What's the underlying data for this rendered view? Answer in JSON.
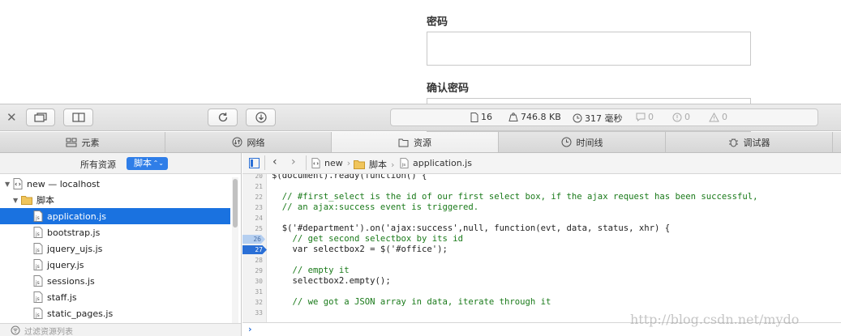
{
  "web": {
    "password_label": "密码",
    "confirm_label": "确认密码"
  },
  "toolbar": {
    "stats": {
      "requests": "16",
      "size": "746.8 KB",
      "time": "317 毫秒",
      "logs": "0",
      "errors": "0",
      "warnings": "0"
    }
  },
  "tabs": [
    {
      "label": "元素",
      "icon": "elements-icon"
    },
    {
      "label": "网络",
      "icon": "network-icon"
    },
    {
      "label": "资源",
      "icon": "resources-icon"
    },
    {
      "label": "时间线",
      "icon": "timeline-icon"
    },
    {
      "label": "调试器",
      "icon": "debugger-icon"
    }
  ],
  "sidebar": {
    "header_label": "所有资源",
    "select_value": "脚本",
    "tree": [
      {
        "label": "new — localhost",
        "level": 0,
        "type": "page",
        "selected": false
      },
      {
        "label": "脚本",
        "level": 1,
        "type": "folder",
        "selected": false
      },
      {
        "label": "application.js",
        "level": 2,
        "type": "js",
        "selected": true
      },
      {
        "label": "bootstrap.js",
        "level": 2,
        "type": "js",
        "selected": false
      },
      {
        "label": "jquery_ujs.js",
        "level": 2,
        "type": "js",
        "selected": false
      },
      {
        "label": "jquery.js",
        "level": 2,
        "type": "js",
        "selected": false
      },
      {
        "label": "sessions.js",
        "level": 2,
        "type": "js",
        "selected": false
      },
      {
        "label": "staff.js",
        "level": 2,
        "type": "js",
        "selected": false
      },
      {
        "label": "static_pages.js",
        "level": 2,
        "type": "js",
        "selected": false
      }
    ],
    "filter_placeholder": "过滤资源列表"
  },
  "breadcrumb": [
    "new",
    "脚本",
    "application.js"
  ],
  "code": {
    "lines": [
      {
        "n": "20",
        "text": "$(document).ready(function() {",
        "comment": false,
        "bp": "none"
      },
      {
        "n": "21",
        "text": "",
        "comment": false,
        "bp": "none"
      },
      {
        "n": "22",
        "text": "  // #first_select is the id of our first select box, if the ajax request has been successful,",
        "comment": true,
        "bp": "none"
      },
      {
        "n": "23",
        "text": "  // an ajax:success event is triggered.",
        "comment": true,
        "bp": "none"
      },
      {
        "n": "24",
        "text": "",
        "comment": false,
        "bp": "none"
      },
      {
        "n": "25",
        "text": "  $('#department').on('ajax:success',null, function(evt, data, status, xhr) {",
        "comment": false,
        "bp": "none"
      },
      {
        "n": "26",
        "text": "    // get second selectbox by its id",
        "comment": true,
        "bp": "inactive"
      },
      {
        "n": "27",
        "text": "    var selectbox2 = $('#office');",
        "comment": false,
        "bp": "active"
      },
      {
        "n": "28",
        "text": "",
        "comment": false,
        "bp": "none"
      },
      {
        "n": "29",
        "text": "    // empty it",
        "comment": true,
        "bp": "none"
      },
      {
        "n": "30",
        "text": "    selectbox2.empty();",
        "comment": false,
        "bp": "none"
      },
      {
        "n": "31",
        "text": "",
        "comment": false,
        "bp": "none"
      },
      {
        "n": "32",
        "text": "    // we got a JSON array in data, iterate through it",
        "comment": true,
        "bp": "none"
      },
      {
        "n": "33",
        "text": "",
        "comment": false,
        "bp": "none"
      }
    ]
  },
  "console": {
    "prompt": "›"
  },
  "watermark": "http://blog.csdn.net/mydo"
}
